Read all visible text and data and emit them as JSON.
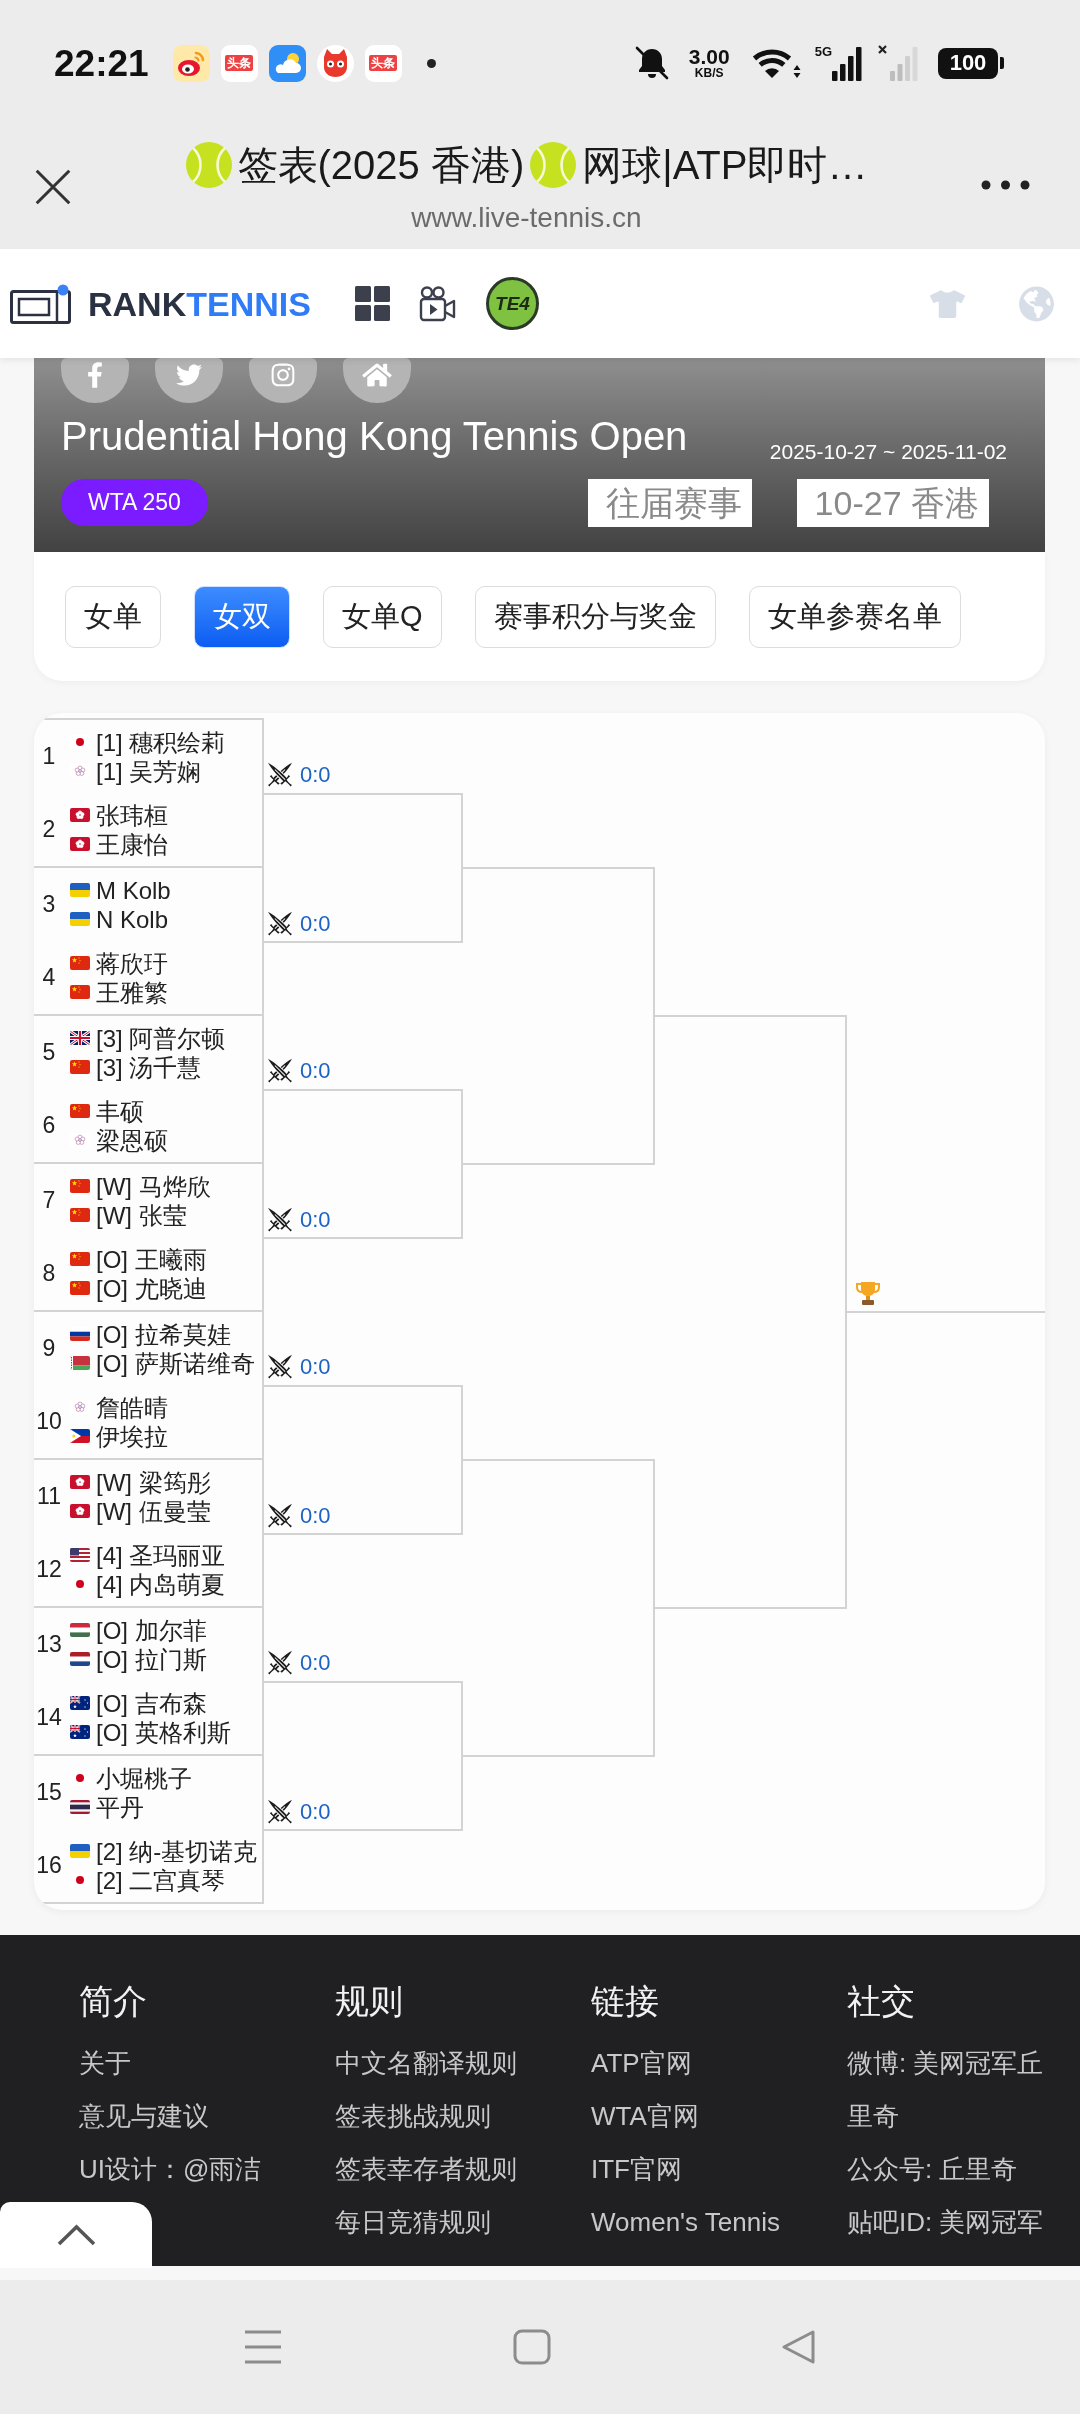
{
  "status_bar": {
    "time": "22:21",
    "notifications": [
      {
        "kind": "weibo"
      },
      {
        "kind": "toutiao",
        "label": "头条"
      },
      {
        "kind": "weather"
      },
      {
        "kind": "cat"
      },
      {
        "kind": "toutiao",
        "label": "头条"
      }
    ],
    "network_speed": {
      "value": "3.00",
      "unit": "KB/S"
    },
    "network_type": "5G",
    "battery": "100"
  },
  "browser_bar": {
    "title_segments": [
      {
        "kind": "ball"
      },
      {
        "kind": "text",
        "text": "签表(2025 香港)"
      },
      {
        "kind": "ball"
      },
      {
        "kind": "text",
        "text": "网球|ATP即时…"
      }
    ],
    "url": "www.live-tennis.cn"
  },
  "site_header": {
    "logo": {
      "part_1": "RANK",
      "part_2": "TENNIS"
    },
    "badge": "TE4"
  },
  "banner": {
    "social_links": [
      {
        "kind": "facebook"
      },
      {
        "kind": "twitter"
      },
      {
        "kind": "instagram"
      },
      {
        "kind": "home"
      }
    ],
    "title": "Prudential Hong Kong Tennis Open",
    "dates": "2025-10-27 ~ 2025-11-02",
    "category": "WTA 250",
    "selects": [
      {
        "value": "往届赛事"
      },
      {
        "value": "10-27 香港"
      }
    ]
  },
  "tabs": [
    {
      "label": "女单",
      "selected": false
    },
    {
      "label": "女双",
      "selected": true
    },
    {
      "label": "女单Q",
      "selected": false
    },
    {
      "label": "赛事积分与奖金",
      "selected": false
    },
    {
      "label": "女单参赛名单",
      "selected": false
    }
  ],
  "draw": {
    "matches": [
      {
        "score": "0:0",
        "entries": [
          {
            "number": "1",
            "players": [
              {
                "kind": "jpn",
                "name": "[1] 穗积绘莉"
              },
              {
                "kind": "tpe",
                "name": "[1] 吴芳娴"
              }
            ]
          },
          {
            "number": "2",
            "players": [
              {
                "kind": "hkg",
                "name": "张玮桓"
              },
              {
                "kind": "hkg",
                "name": "王康怡"
              }
            ]
          }
        ]
      },
      {
        "score": "0:0",
        "entries": [
          {
            "number": "3",
            "players": [
              {
                "kind": "ukr",
                "name": "M Kolb"
              },
              {
                "kind": "ukr",
                "name": "N Kolb"
              }
            ]
          },
          {
            "number": "4",
            "players": [
              {
                "kind": "chn",
                "name": "蒋欣玗"
              },
              {
                "kind": "chn",
                "name": "王雅繁"
              }
            ]
          }
        ]
      },
      {
        "score": "0:0",
        "entries": [
          {
            "number": "5",
            "players": [
              {
                "kind": "gbr",
                "name": "[3] 阿普尔顿"
              },
              {
                "kind": "chn",
                "name": "[3] 汤千慧"
              }
            ]
          },
          {
            "number": "6",
            "players": [
              {
                "kind": "chn",
                "name": "丰硕"
              },
              {
                "kind": "tpe",
                "name": "梁恩硕"
              }
            ]
          }
        ]
      },
      {
        "score": "0:0",
        "entries": [
          {
            "number": "7",
            "players": [
              {
                "kind": "chn",
                "name": "[W] 马烨欣"
              },
              {
                "kind": "chn",
                "name": "[W] 张莹"
              }
            ]
          },
          {
            "number": "8",
            "players": [
              {
                "kind": "chn",
                "name": "[O] 王曦雨"
              },
              {
                "kind": "chn",
                "name": "[O] 尤晓迪"
              }
            ]
          }
        ]
      },
      {
        "score": "0:0",
        "entries": [
          {
            "number": "9",
            "players": [
              {
                "kind": "rus",
                "name": "[O] 拉希莫娃"
              },
              {
                "kind": "blr",
                "name": "[O] 萨斯诺维奇"
              }
            ]
          },
          {
            "number": "10",
            "players": [
              {
                "kind": "tpe",
                "name": "詹皓晴"
              },
              {
                "kind": "phi",
                "name": "伊埃拉"
              }
            ]
          }
        ]
      },
      {
        "score": "0:0",
        "entries": [
          {
            "number": "11",
            "players": [
              {
                "kind": "hkg",
                "name": "[W] 梁筠彤"
              },
              {
                "kind": "hkg",
                "name": "[W] 伍曼莹"
              }
            ]
          },
          {
            "number": "12",
            "players": [
              {
                "kind": "usa",
                "name": "[4] 圣玛丽亚"
              },
              {
                "kind": "jpn",
                "name": "[4] 内岛萌夏"
              }
            ]
          }
        ]
      },
      {
        "score": "0:0",
        "entries": [
          {
            "number": "13",
            "players": [
              {
                "kind": "hun",
                "name": "[O] 加尔菲"
              },
              {
                "kind": "ned",
                "name": "[O] 拉门斯"
              }
            ]
          },
          {
            "number": "14",
            "players": [
              {
                "kind": "aus",
                "name": "[O] 吉布森"
              },
              {
                "kind": "aus",
                "name": "[O] 英格利斯"
              }
            ]
          }
        ]
      },
      {
        "score": "0:0",
        "entries": [
          {
            "number": "15",
            "players": [
              {
                "kind": "jpn",
                "name": "小堀桃子"
              },
              {
                "kind": "tha",
                "name": "平丹"
              }
            ]
          },
          {
            "number": "16",
            "players": [
              {
                "kind": "ukr",
                "name": "[2] 纳-基切诺克"
              },
              {
                "kind": "jpn",
                "name": "[2] 二宫真琴"
              }
            ]
          }
        ]
      }
    ]
  },
  "footer": {
    "columns": [
      {
        "heading": "简介",
        "links": [
          "关于",
          "意见与建议",
          "UI设计：@雨洁"
        ]
      },
      {
        "heading": "规则",
        "links": [
          "中文名翻译规则",
          "签表挑战规则",
          "签表幸存者规则",
          "每日竞猜规则"
        ]
      },
      {
        "heading": "链接",
        "links": [
          "ATP官网",
          "WTA官网",
          "ITF官网",
          "Women's Tennis"
        ]
      },
      {
        "heading": "社交",
        "links": [
          "微博: 美网冠军丘里奇",
          "公众号: 丘里奇",
          "贴吧ID: 美网冠军"
        ]
      }
    ]
  }
}
